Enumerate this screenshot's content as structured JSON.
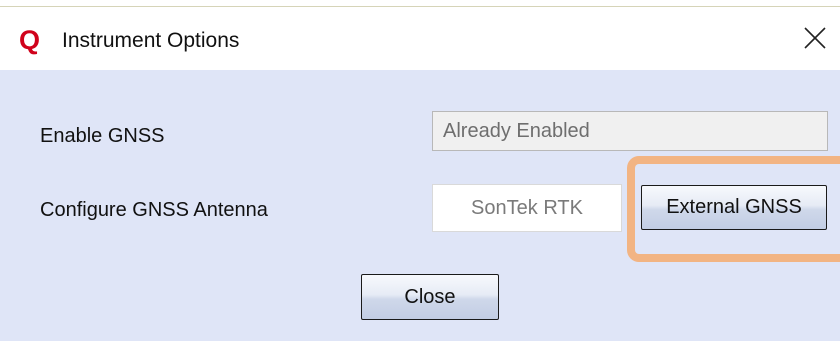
{
  "window": {
    "title": "Instrument Options",
    "app_icon_letter": "Q"
  },
  "colors": {
    "app_icon": "#d0021b",
    "content_background": "#dfe5f7",
    "highlight": "#f2b483"
  },
  "icons": {
    "app": "q-logo-icon",
    "close": "close-x-icon"
  },
  "rows": {
    "enable_gnss": {
      "label": "Enable GNSS",
      "value": "Already Enabled"
    },
    "configure_antenna": {
      "label": "Configure GNSS Antenna",
      "option_sontek": "SonTek RTK",
      "option_external": "External GNSS"
    }
  },
  "footer": {
    "close_label": "Close"
  }
}
